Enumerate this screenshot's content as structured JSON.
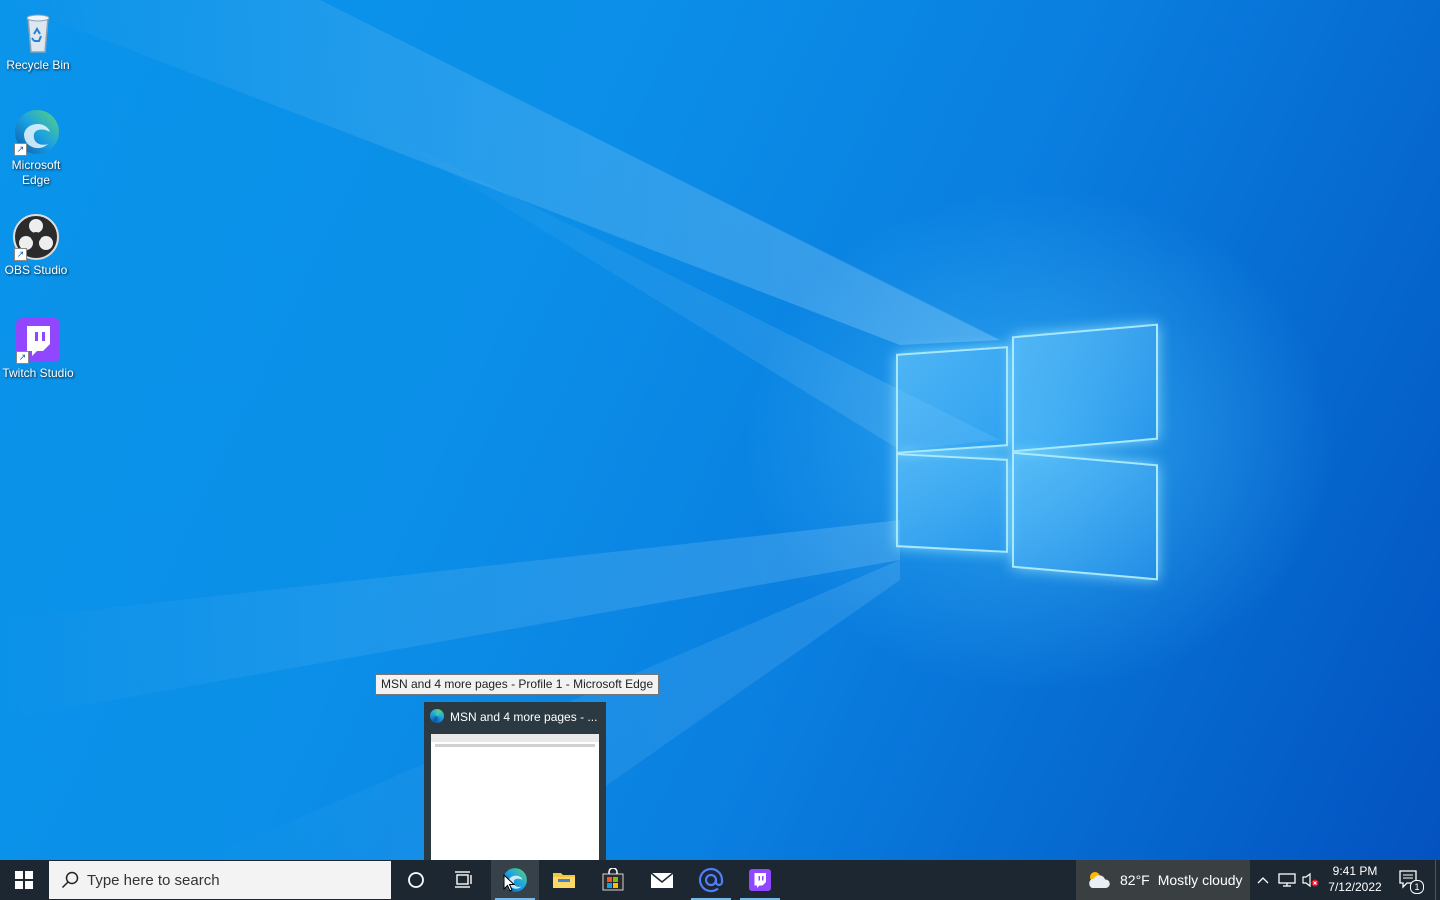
{
  "desktop": {
    "icons": [
      {
        "label": "Recycle Bin",
        "icon": "recycle-bin-icon"
      },
      {
        "label": "Microsoft Edge",
        "icon": "edge-icon"
      },
      {
        "label": "OBS Studio",
        "icon": "obs-icon"
      },
      {
        "label": "Twitch Studio",
        "icon": "twitch-icon"
      }
    ]
  },
  "tooltip": {
    "text": "MSN and 4 more pages - Profile 1 - Microsoft Edge"
  },
  "thumbnail": {
    "title": "MSN and 4 more pages - ..."
  },
  "taskbar": {
    "search_placeholder": "Type here to search",
    "pinned": [
      {
        "name": "cortana",
        "icon": "cortana-icon"
      },
      {
        "name": "task-view",
        "icon": "task-view-icon"
      },
      {
        "name": "microsoft-edge",
        "icon": "edge-icon",
        "running": true
      },
      {
        "name": "file-explorer",
        "icon": "folder-icon"
      },
      {
        "name": "microsoft-store",
        "icon": "store-icon"
      },
      {
        "name": "mail",
        "icon": "mail-icon"
      },
      {
        "name": "email-client",
        "icon": "at-sign-icon",
        "running": true
      },
      {
        "name": "twitch",
        "icon": "twitch-icon",
        "running": true
      }
    ],
    "weather": {
      "temperature": "82°F",
      "condition": "Mostly cloudy"
    },
    "clock": {
      "time": "9:41 PM",
      "date": "7/12/2022"
    },
    "notification_count": "1"
  },
  "colors": {
    "taskbar": "#1c2731",
    "accent": "#76b9ed",
    "desktop": "#0a8fe8"
  }
}
